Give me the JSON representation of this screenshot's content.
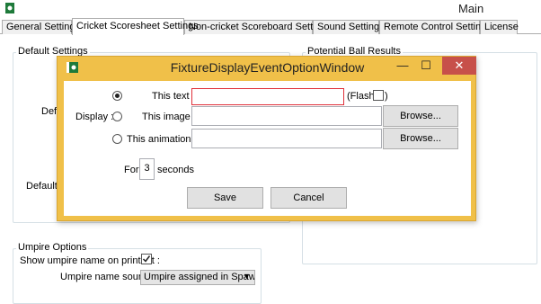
{
  "window": {
    "title": "Main"
  },
  "tabs": [
    {
      "label": "General Settings"
    },
    {
      "label": "Cricket Scoresheet Settings"
    },
    {
      "label": "Non-cricket Scoreboard Settings"
    },
    {
      "label": "Sound Settings"
    },
    {
      "label": "Remote Control Settings"
    },
    {
      "label": "License"
    }
  ],
  "active_tab_index": 1,
  "left_panel": {
    "group_title": "Default Settings",
    "label_partial_1": "Defa",
    "label_partial_2": "Default a"
  },
  "right_panel": {
    "group_title": "Potential Ball Results"
  },
  "umpire": {
    "group_title": "Umpire Options",
    "show_name_label": "Show umpire name on printout :",
    "show_name_checked": true,
    "source_label": "Umpire name source :",
    "source_value": "Umpire assigned in Spawt"
  },
  "dialog": {
    "title": "FixtureDisplayEventOptionWindow",
    "display_label": "Display :",
    "options": [
      {
        "label": "This text :",
        "value": "",
        "selected": true
      },
      {
        "label": "This image :",
        "value": "",
        "selected": false,
        "button": "Browse..."
      },
      {
        "label": "This animation :",
        "value": "",
        "selected": false,
        "button": "Browse..."
      }
    ],
    "flash_label": "(Flash",
    "flash_suffix": ")",
    "flash_checked": false,
    "for_label": "For",
    "seconds_value": "3",
    "seconds_label": "seconds",
    "save_label": "Save",
    "cancel_label": "Cancel",
    "minimize_glyph": "—",
    "maximize_glyph": "☐",
    "close_glyph": "✕"
  },
  "colors": {
    "dialog_frame": "#f0c049",
    "close_button": "#c7504a",
    "invalid_border": "#e0303a"
  }
}
